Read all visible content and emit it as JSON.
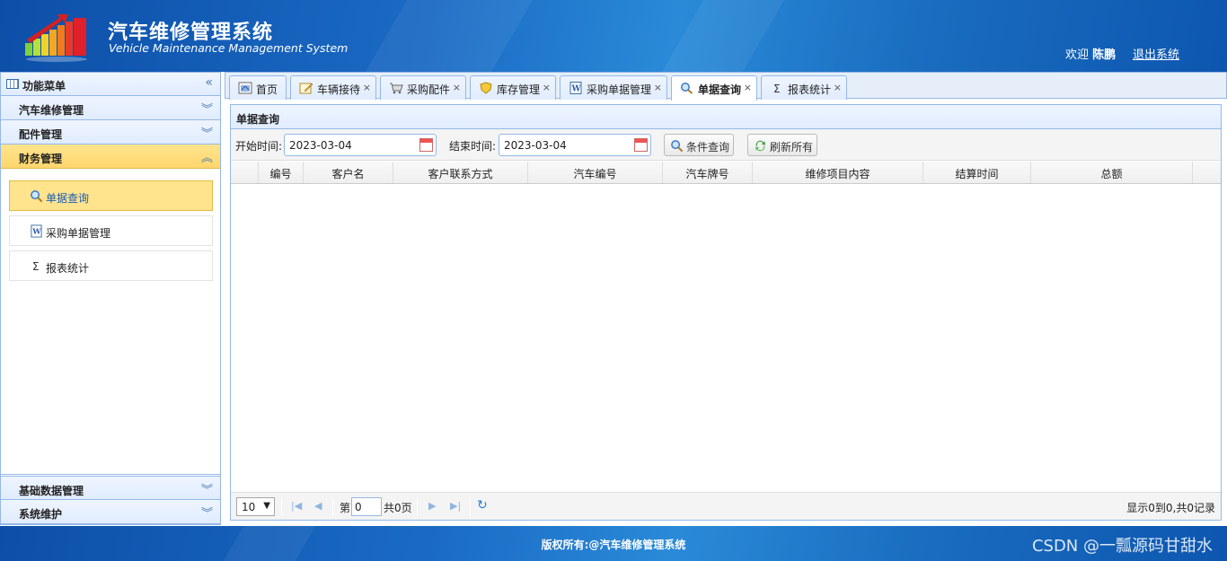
{
  "header": {
    "title": "汽车维修管理系统",
    "subtitle": "Vehicle Maintenance Management System",
    "welcome_prefix": "欢迎",
    "username": "陈鹏",
    "logout_label": "退出系统"
  },
  "sidebar": {
    "title": "功能菜单",
    "sections": [
      {
        "label": "汽车维修管理"
      },
      {
        "label": "配件管理"
      },
      {
        "label": "财务管理"
      }
    ],
    "finance_items": [
      {
        "label": "单据查询",
        "icon": "search-icon"
      },
      {
        "label": "采购单据管理",
        "icon": "document-icon"
      },
      {
        "label": "报表统计",
        "icon": "sigma-icon"
      }
    ],
    "bottom_sections": [
      {
        "label": "基础数据管理"
      },
      {
        "label": "系统维护"
      }
    ]
  },
  "tabs": [
    {
      "label": "首页",
      "icon": "home-icon"
    },
    {
      "label": "车辆接待",
      "icon": "edit-icon"
    },
    {
      "label": "采购配件",
      "icon": "cart-icon"
    },
    {
      "label": "库存管理",
      "icon": "shield-icon"
    },
    {
      "label": "采购单据管理",
      "icon": "document-icon"
    },
    {
      "label": "单据查询",
      "icon": "search-icon"
    },
    {
      "label": "报表统计",
      "icon": "sigma-icon"
    }
  ],
  "panel": {
    "title": "单据查询",
    "start_label": "开始时间:",
    "start_value": "2023-03-04",
    "end_label": "结束时间:",
    "end_value": "2023-03-04",
    "query_button": "条件查询",
    "refresh_button": "刷新所有"
  },
  "grid": {
    "columns": [
      "编号",
      "客户名",
      "客户联系方式",
      "汽车编号",
      "汽车牌号",
      "维修项目内容",
      "结算时间",
      "总额"
    ]
  },
  "pager": {
    "page_size": "10",
    "page_prefix": "第",
    "page_value": "0",
    "page_total": "共0页",
    "info": "显示0到0,共0记录"
  },
  "footer": {
    "copyright": "版权所有:@汽车维修管理系统",
    "watermark": "CSDN @一瓢源码甘甜水"
  },
  "colors": {
    "header_blue": "#1a6ac4",
    "active_yellow": "#ffe48d",
    "border_blue": "#95b8e7"
  }
}
